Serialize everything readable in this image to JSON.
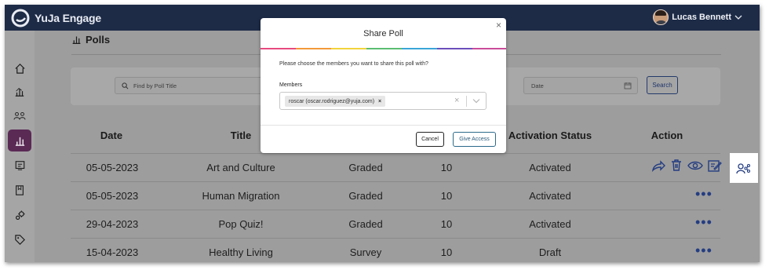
{
  "app": {
    "name": "YuJa Engage"
  },
  "user": {
    "name": "Lucas Bennett"
  },
  "sidebar": {
    "items": [
      {
        "name": "home-icon",
        "active": false
      },
      {
        "name": "analytics-icon",
        "active": false
      },
      {
        "name": "groups-icon",
        "active": false
      },
      {
        "name": "polls-icon",
        "active": true
      },
      {
        "name": "slides-icon",
        "active": false
      },
      {
        "name": "notebook-icon",
        "active": false
      },
      {
        "name": "integrations-icon",
        "active": false
      },
      {
        "name": "tag-icon",
        "active": false
      }
    ]
  },
  "page": {
    "title": "Polls"
  },
  "filters": {
    "search_placeholder": "Find by Poll Title",
    "date_placeholder": "Date",
    "search_button": "Search"
  },
  "table": {
    "headers": {
      "date": "Date",
      "title": "Title",
      "activation_status": "Activation Status",
      "action": "Action"
    },
    "rows": [
      {
        "date": "05-05-2023",
        "title": "Art and Culture",
        "type": "Graded",
        "count": "10",
        "status": "Activated"
      },
      {
        "date": "05-05-2023",
        "title": "Human Migration",
        "type": "Graded",
        "count": "10",
        "status": "Activated",
        "actions": "•••"
      },
      {
        "date": "29-04-2023",
        "title": "Pop Quiz!",
        "type": "Graded",
        "count": "10",
        "status": "Activated",
        "actions": "•••"
      },
      {
        "date": "15-04-2023",
        "title": "Healthy Living",
        "type": "Survey",
        "count": "10",
        "status": "Draft",
        "actions": "•••"
      }
    ]
  },
  "modal": {
    "title": "Share Poll",
    "close": "×",
    "description": "Please choose the members you want to share this poll with?",
    "members_label": "Members",
    "selected_member": "roscar (oscar.rodriguez@yuja.com)",
    "chip_remove": "×",
    "clear": "×",
    "cancel_button": "Cancel",
    "give_access_button": "Give Access"
  },
  "colors": {
    "header": "#1d2b47",
    "active_sidebar": "#5a2a55",
    "action_blue": "#243d82",
    "accent_bar": [
      "#e84a7f",
      "#f29a3a",
      "#f2d23c",
      "#5bbd72",
      "#3aa6d6",
      "#6b4fbb",
      "#c94c9a"
    ]
  }
}
